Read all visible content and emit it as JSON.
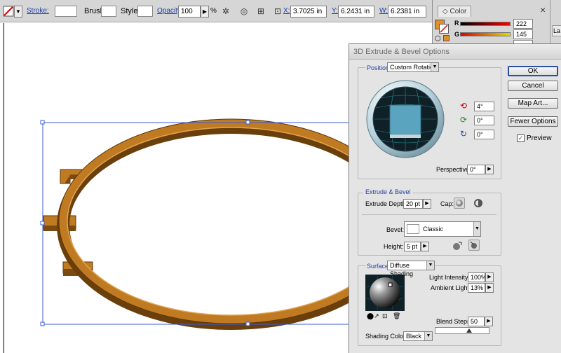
{
  "control_bar": {
    "stroke_label": "Stroke:",
    "brush_label": "Brush:",
    "style_label": "Style:",
    "opacity_label": "Opacity:",
    "opacity_value": "100",
    "opacity_unit": "%",
    "x_label": "X:",
    "x_value": "3.7025 in",
    "y_label": "Y:",
    "y_value": "6.2431 in",
    "w_label": "W:",
    "w_value": "6.2381 in"
  },
  "color_panel": {
    "tab_label": "Color",
    "r_label": "R",
    "r_value": "222",
    "g_label": "G",
    "g_value": "145",
    "b_value": "",
    "fill_color": "#de9128"
  },
  "right_panel": {
    "tab_label": "La"
  },
  "dialog": {
    "title": "3D Extrude & Bevel Options",
    "ok_label": "OK",
    "cancel_label": "Cancel",
    "map_art_label": "Map Art...",
    "fewer_options_label": "Fewer Options",
    "preview_label": "Preview",
    "preview_checked": "✓",
    "position": {
      "label": "Position:",
      "value": "Custom Rotation",
      "x_rotation": "4°",
      "y_rotation": "0°",
      "z_rotation": "0°",
      "perspective_label": "Perspective:",
      "perspective_value": "0°"
    },
    "extrude": {
      "legend": "Extrude & Bevel",
      "depth_label": "Extrude Depth:",
      "depth_value": "20 pt",
      "cap_label": "Cap:",
      "bevel_label": "Bevel:",
      "bevel_value": "Classic",
      "height_label": "Height:",
      "height_value": "5 pt"
    },
    "surface": {
      "label": "Surface:",
      "value": "Diffuse Shading",
      "light_intensity_label": "Light Intensity:",
      "light_intensity_value": "100%",
      "ambient_light_label": "Ambient Light:",
      "ambient_light_value": "13%",
      "blend_steps_label": "Blend Steps:",
      "blend_steps_value": "50",
      "shading_color_label": "Shading Color:",
      "shading_color_value": "Black"
    }
  },
  "colors": {
    "object_fill": "#c07b22",
    "object_dark": "#7a4a10",
    "selection": "#3a5bd9",
    "accent_link": "#1f3fa8"
  }
}
